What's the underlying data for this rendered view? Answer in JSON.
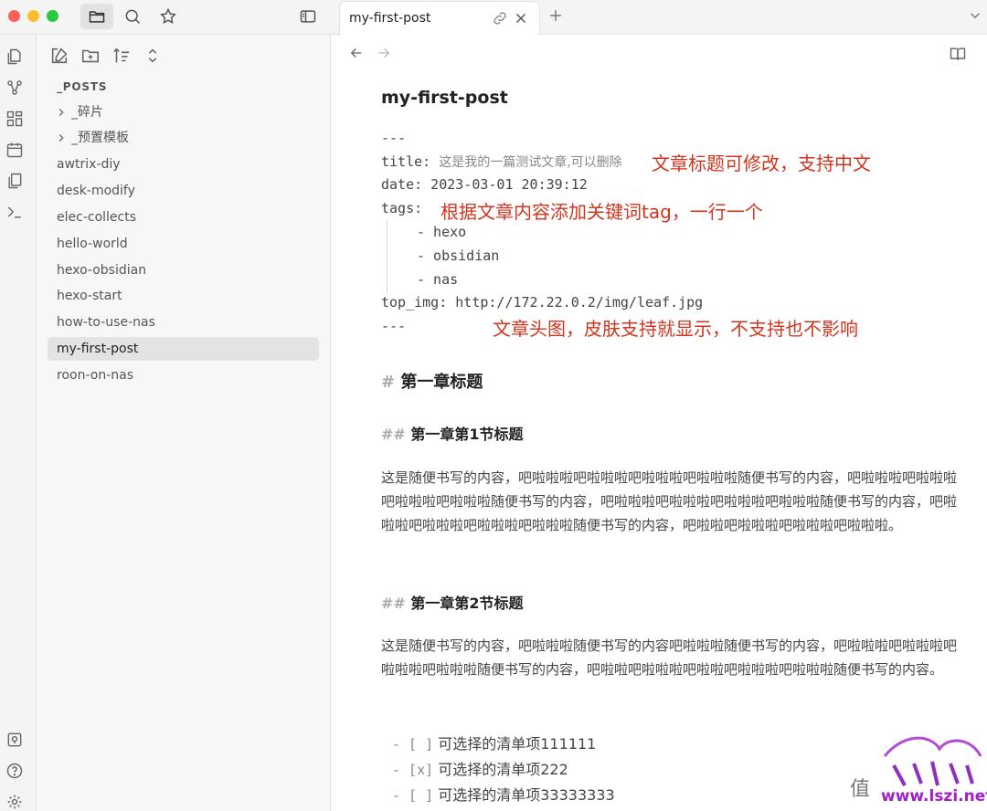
{
  "window": {
    "tab_title": "my-first-post"
  },
  "icons": {
    "top_left": [
      "folder-icon",
      "search-icon",
      "star-icon",
      "sidebar-toggle-icon"
    ],
    "ribbon": [
      "open-switcher-icon",
      "graph-view-icon",
      "canvas-icon",
      "daily-note-icon",
      "templates-icon",
      "terminal-icon",
      "vault-icon",
      "help-icon",
      "settings-icon"
    ],
    "explorer_tools": [
      "new-note-icon",
      "new-folder-icon",
      "sort-icon",
      "collapse-icon"
    ]
  },
  "explorer": {
    "root": "_POSTS",
    "folders": [
      "_碎片",
      "_预置模板"
    ],
    "files": [
      "awtrix-diy",
      "desk-modify",
      "elec-collects",
      "hello-world",
      "hexo-obsidian",
      "hexo-start",
      "how-to-use-nas",
      "my-first-post",
      "roon-on-nas"
    ],
    "selected": "my-first-post"
  },
  "doc": {
    "title": "my-first-post",
    "frontmatter": {
      "open": "---",
      "title_key": "title:",
      "title_value": "这是我的一篇测试文章,可以删除",
      "date_line": "date: 2023-03-01 20:39:12",
      "tags_key": "tags:",
      "tags": [
        "- hexo",
        "- obsidian",
        "- nas"
      ],
      "top_img_line": "top_img: http://172.22.0.2/img/leaf.jpg",
      "close": "---"
    },
    "annotations": {
      "title_note": "文章标题可修改，支持中文",
      "tags_note": "根据文章内容添加关键词tag，一行一个",
      "img_note": "文章头图，皮肤支持就显示，不支持也不影响"
    },
    "h1_mark": "#",
    "h1": "第一章标题",
    "h2_mark": "##",
    "h2_a": "第一章第1节标题",
    "para_a": "这是随便书写的内容，吧啦啦啦吧啦啦啦吧啦啦啦吧啦啦啦随便书写的内容，吧啦啦啦吧啦啦啦吧啦啦啦吧啦啦啦随便书写的内容，吧啦啦啦吧啦啦啦吧啦啦啦吧啦啦啦随便书写的内容，吧啦啦啦吧啦啦啦吧啦啦啦吧啦啦啦随便书写的内容，吧啦啦吧啦啦啦吧啦啦啦吧啦啦啦。",
    "h2_b": "第一章第2节标题",
    "para_b": "这是随便书写的内容，吧啦啦啦随便书写的内容吧啦啦啦随便书写的内容，吧啦啦啦吧啦啦啦吧啦啦啦吧啦啦啦随便书写的内容，吧啦啦吧啦啦啦吧啦啦吧啦啦啦吧啦啦啦随便书写的内容。",
    "tasks": [
      {
        "mark": "- [ ]",
        "text": "可选择的清单项111111"
      },
      {
        "mark": "- [x]",
        "text": "可选择的清单项222"
      },
      {
        "mark": "- [ ]",
        "text": "可选择的清单项33333333"
      }
    ]
  },
  "watermark": {
    "value_char": "值",
    "url": "www.lszi.net"
  }
}
